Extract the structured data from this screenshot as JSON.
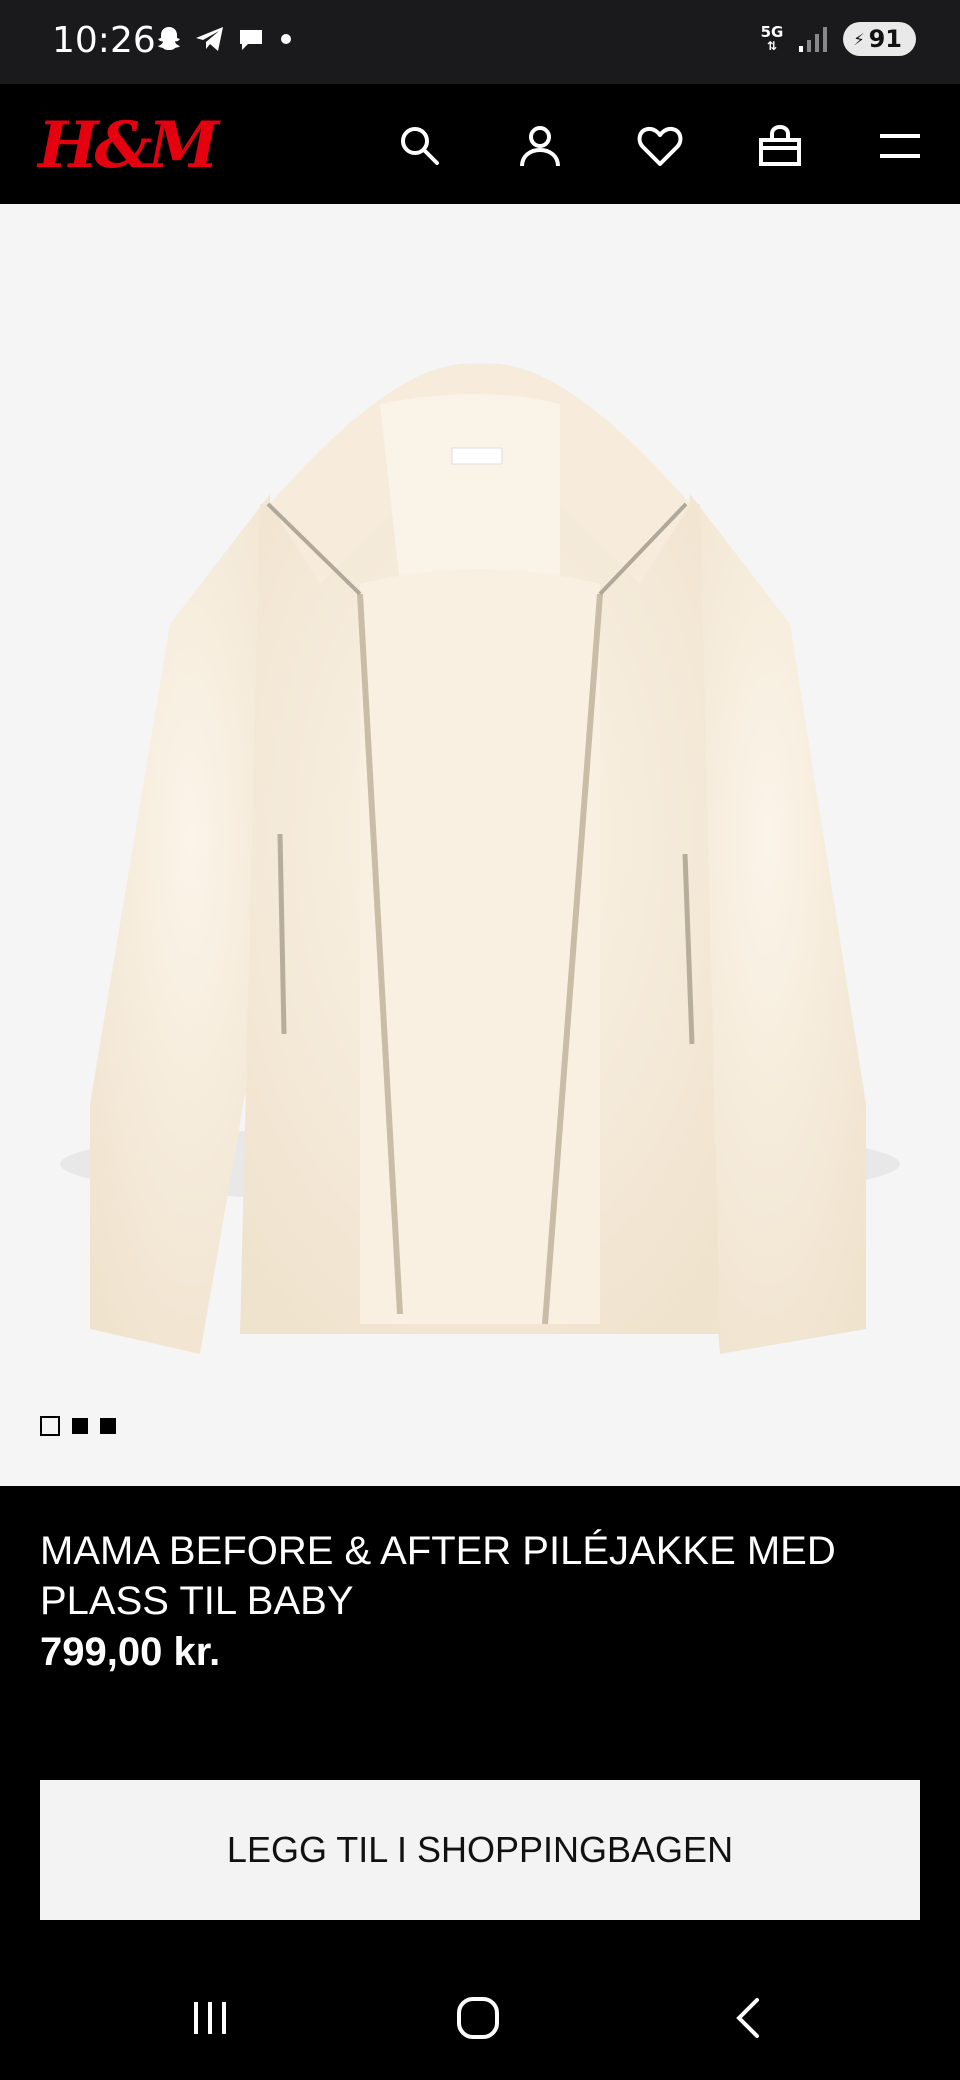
{
  "status_bar": {
    "time": "10:26",
    "network_label": "5G",
    "battery": "91"
  },
  "header": {
    "logo": "H&M",
    "icons": [
      "search-icon",
      "account-icon",
      "favorites-icon",
      "shopping-bag-icon",
      "menu-icon"
    ],
    "brand_color": "#e50010"
  },
  "gallery": {
    "image": "cream teddy fleece jacket",
    "slide_count": 3,
    "active_slide": 1
  },
  "product": {
    "name": "MAMA BEFORE & AFTER PILÉJAKKE MED PLASS TIL BABY",
    "price": "799,00 kr.",
    "add_to_bag_label": "LEGG TIL I SHOPPINGBAGEN"
  },
  "system_nav": {
    "icons": [
      "recent-apps-icon",
      "home-icon",
      "back-icon"
    ]
  }
}
